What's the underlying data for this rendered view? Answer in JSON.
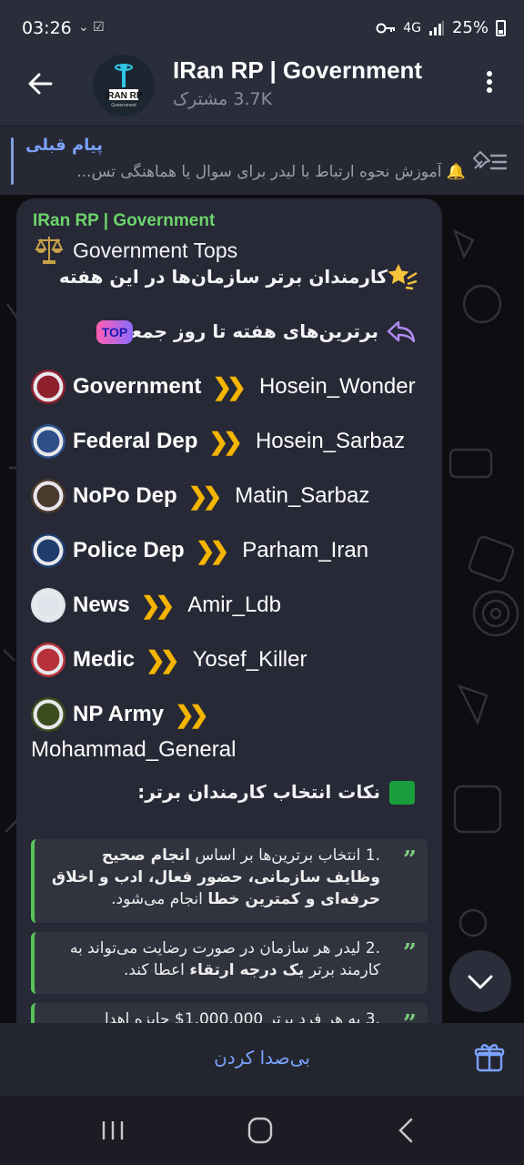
{
  "status_bar": {
    "time": "03:26",
    "left_icons": "⌄ ☑",
    "right_icons": "4G",
    "battery": "25%"
  },
  "header": {
    "title": "IRan RP | Government",
    "subscribers": "3.7K مشترک",
    "avatar_label": "IRAN RP",
    "avatar_sub": "Government"
  },
  "pinned": {
    "title": "پیام قبلی",
    "text": "🔔 آموزش نحوه ارتباط با لیدر برای سوال یا هماهنگی تس..."
  },
  "message": {
    "sender": "IRan RP | Government",
    "line1": "Government Tops",
    "line2": "کارمندان برتر سازمان‌ها در این هفته",
    "line3": "برترین‌های هفته تا روز جمعه",
    "tops_badge": "TOP",
    "rows": [
      {
        "dep": "Government",
        "name": "Hosein_Wonder",
        "seal": "#8e1f2c"
      },
      {
        "dep": "Federal Dep",
        "name": "Hosein_Sarbaz",
        "seal": "#2c4f8a"
      },
      {
        "dep": "NoPo Dep",
        "name": "Matin_Sarbaz",
        "seal": "#4a3a2c"
      },
      {
        "dep": "Police Dep",
        "name": "Parham_Iran",
        "seal": "#1f3c6e"
      },
      {
        "dep": "News",
        "name": "Amir_Ldb",
        "seal": "#dfe3ea"
      },
      {
        "dep": "Medic",
        "name": "Yosef_Killer",
        "seal": "#b8323c"
      },
      {
        "dep": "NP Army",
        "name": "Mohammad_General",
        "seal": "#3b4d1e"
      }
    ],
    "tips_title": "نکات انتخاب کارمندان برتر:",
    "quote1_num": ".1",
    "quote1_a": "انتخاب برترین‌ها بر اساس ",
    "quote1_b": "انجام صحیح وظایف سازمانی، حضور فعال، ادب و اخلاق حرفه‌ای و کمترین خطا",
    "quote1_c": " انجام می‌شود.",
    "quote2_num": ".2",
    "quote2_a": "لیدر هر سازمان در صورت رضایت می‌تواند به کارمند برتر ",
    "quote2_b": "یک درجه ارتقاء",
    "quote2_c": " اعطا کند.",
    "quote3_partial": ".3 به هر فرد برتر 1,000,000$ جایزه اهدا"
  },
  "bottom": {
    "mute_label": "بی‌صدا کردن"
  },
  "colors": {
    "accent": "#7aa2ff",
    "sender_green": "#6cd46c",
    "chevron_gold": "#f5b400",
    "bubble": "#272936",
    "header": "#2a2d3a"
  }
}
